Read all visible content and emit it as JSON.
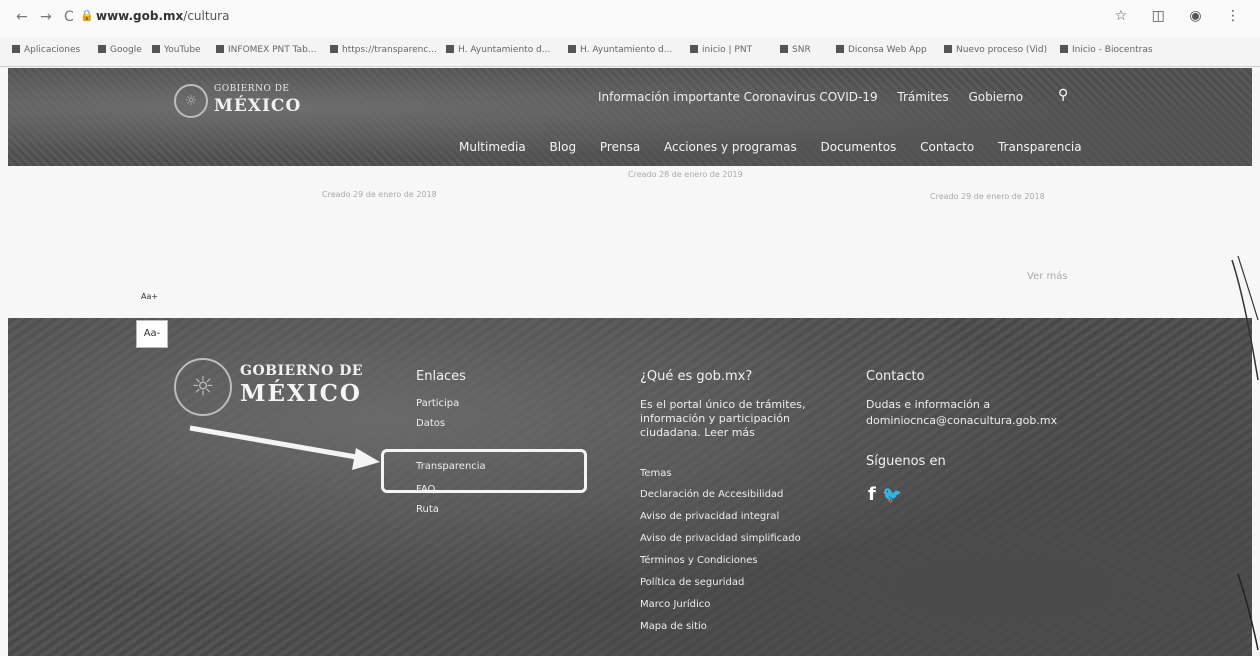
{
  "browser": {
    "url_domain": "www.gob.mx",
    "url_path": "/cultura",
    "bookmarks": [
      "Aplicaciones",
      "Google",
      "YouTube",
      "INFOMEX PNT Tab...",
      "https://transparenc...",
      "H. Ayuntamiento d...",
      "H. Ayuntamiento d...",
      "inicio | PNT",
      "SNR",
      "Diconsa Web App",
      "Nuevo proceso (Vid)",
      "Inicio - Biocentras"
    ]
  },
  "header": {
    "logo_line1": "GOBIERNO DE",
    "logo_line2": "MÉXICO",
    "top_links": [
      "Información importante Coronavirus COVID-19",
      "Trámites",
      "Gobierno"
    ],
    "main_nav": [
      "Multimedia",
      "Blog",
      "Prensa",
      "Acciones y programas",
      "Documentos",
      "Contacto",
      "Transparencia"
    ]
  },
  "content": {
    "dates": [
      "Creado 29 de enero de 2018",
      "Creado 28 de enero de 2019",
      "Creado 29 de enero de 2018"
    ],
    "see_more": "Ver más",
    "font_control_small": "Aa+",
    "font_control": "Aa-"
  },
  "footer": {
    "logo_line1": "GOBIERNO DE",
    "logo_line2": "MÉXICO",
    "links_title": "Enlaces",
    "links": [
      "Participa",
      "Datos",
      "Transparencia",
      "FAQ",
      "Ruta"
    ],
    "about_title": "¿Qué es gob.mx?",
    "about_text": "Es el portal único de trámites, información y participación ciudadana. Leer más",
    "legal_links": [
      "Temas",
      "Declaración de Accesibilidad",
      "Aviso de privacidad integral",
      "Aviso de privacidad simplificado",
      "Términos y Condiciones",
      "Política de seguridad",
      "Marco Jurídico",
      "Mapa de sitio"
    ],
    "contact_title": "Contacto",
    "contact_text": "Dudas e información a",
    "contact_email": "dominiocnca@conacultura.gob.mx",
    "follow_title": "Síguenos en",
    "social_icons": [
      "facebook-icon",
      "twitter-icon"
    ]
  }
}
